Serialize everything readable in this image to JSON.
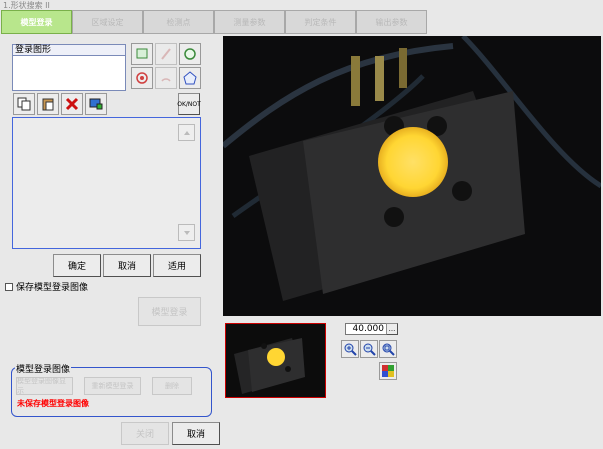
{
  "window": {
    "title": "1.形状搜索 II"
  },
  "tabs": [
    {
      "label": "模型登录",
      "active": true
    },
    {
      "label": "区域设定",
      "active": false
    },
    {
      "label": "检测点",
      "active": false
    },
    {
      "label": "测量参数",
      "active": false
    },
    {
      "label": "判定条件",
      "active": false
    },
    {
      "label": "输出参数",
      "active": false
    }
  ],
  "shape_list": {
    "header": "登录图形"
  },
  "tools": {
    "ok_not_label": "OK/NOT"
  },
  "buttons": {
    "ok": "确定",
    "cancel": "取消",
    "apply": "适用",
    "register_model": "模型登录",
    "close": "关闭",
    "cancel_bottom": "取消"
  },
  "save_option": {
    "label": "保存模型登录图像",
    "checked": false
  },
  "model_image_group": {
    "title": "模型登录图像",
    "btn_display": "模型登录图像显示",
    "btn_redo": "重新模型登录",
    "btn_delete": "删除",
    "warning": "未保存模型登录图像",
    "warning_color": "#ff0000"
  },
  "zoom": {
    "value": "40.000",
    "unit_button": "..."
  },
  "colors": {
    "tab_active": "#b8e68c",
    "panel_border": "#3355cc",
    "thumb_border": "#cc0000",
    "glow": "#ffd633"
  }
}
